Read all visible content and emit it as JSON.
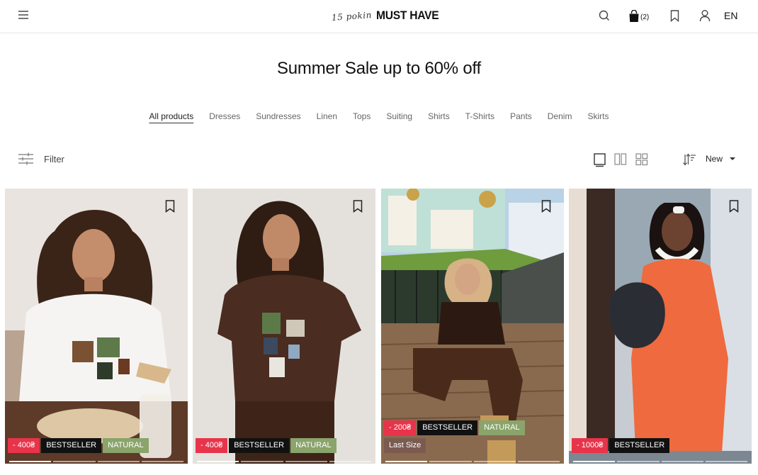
{
  "header": {
    "logo_script": "15 pokin",
    "logo_main": "MUST HAVE",
    "cart_count": "(2)",
    "language": "EN"
  },
  "page_title": "Summer Sale up to 60% off",
  "categories": [
    "All products",
    "Dresses",
    "Sundresses",
    "Linen",
    "Tops",
    "Suiting",
    "Shirts",
    "T-Shirts",
    "Pants",
    "Denim",
    "Skirts"
  ],
  "active_category": "All products",
  "toolbar": {
    "filter_label": "Filter",
    "sort_label": "New"
  },
  "products": [
    {
      "discount": "- 400₴",
      "badges": [
        "BESTSELLER",
        "NATURAL"
      ],
      "extra": ""
    },
    {
      "discount": "- 400₴",
      "badges": [
        "BESTSELLER",
        "NATURAL"
      ],
      "extra": ""
    },
    {
      "discount": "- 200₴",
      "badges": [
        "BESTSELLER",
        "NATURAL"
      ],
      "extra": "Last Size"
    },
    {
      "discount": "- 1000₴",
      "badges": [
        "BESTSELLER"
      ],
      "extra": ""
    }
  ],
  "colors": {
    "sale_badge": "#e7344a",
    "bestseller_badge": "#111111",
    "natural_badge": "#8aa46b",
    "last_size_badge": "#7b5b50"
  },
  "icons": [
    "menu-icon",
    "search-icon",
    "bag-icon",
    "bookmark-icon",
    "user-icon",
    "filter-icon",
    "single-view-icon",
    "double-view-icon",
    "grid-view-icon",
    "sort-icon"
  ]
}
